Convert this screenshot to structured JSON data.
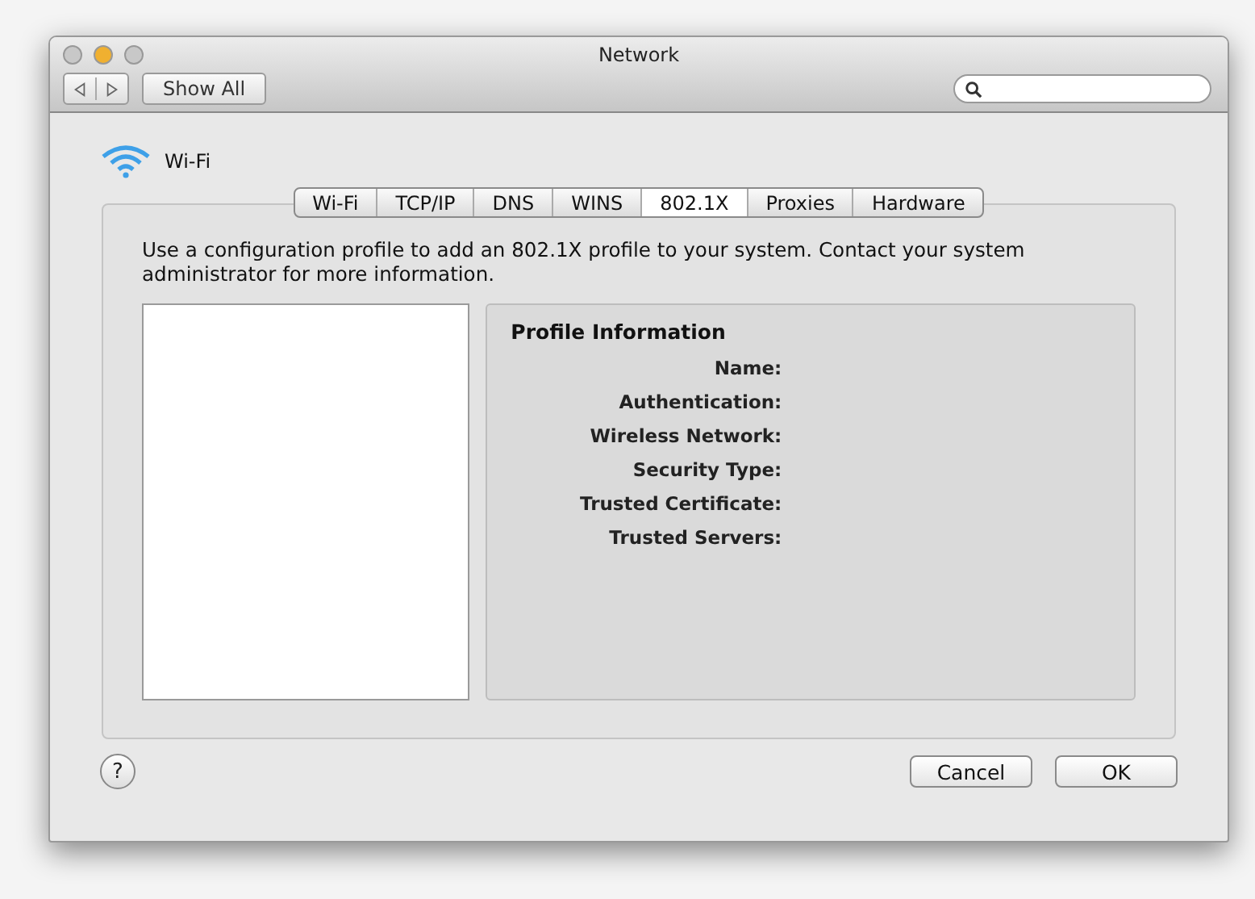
{
  "window": {
    "title": "Network",
    "traffic_lights": [
      {
        "color": "#c8c8c8"
      },
      {
        "color": "#f0b030"
      },
      {
        "color": "#c8c8c8"
      }
    ]
  },
  "toolbar": {
    "show_all": "Show All"
  },
  "service": {
    "name": "Wi-Fi"
  },
  "tabs": [
    {
      "label": "Wi-Fi",
      "selected": false
    },
    {
      "label": "TCP/IP",
      "selected": false
    },
    {
      "label": "DNS",
      "selected": false
    },
    {
      "label": "WINS",
      "selected": false
    },
    {
      "label": "802.1X",
      "selected": true
    },
    {
      "label": "Proxies",
      "selected": false
    },
    {
      "label": "Hardware",
      "selected": false
    }
  ],
  "description": "Use a configuration profile to add an 802.1X profile to your system. Contact your system administrator for more information.",
  "profile_info": {
    "title": "Profile Information",
    "fields": [
      "Name:",
      "Authentication:",
      "Wireless Network:",
      "Security Type:",
      "Trusted Certificate:",
      "Trusted Servers:"
    ]
  },
  "buttons": {
    "cancel": "Cancel",
    "ok": "OK",
    "help": "?"
  }
}
